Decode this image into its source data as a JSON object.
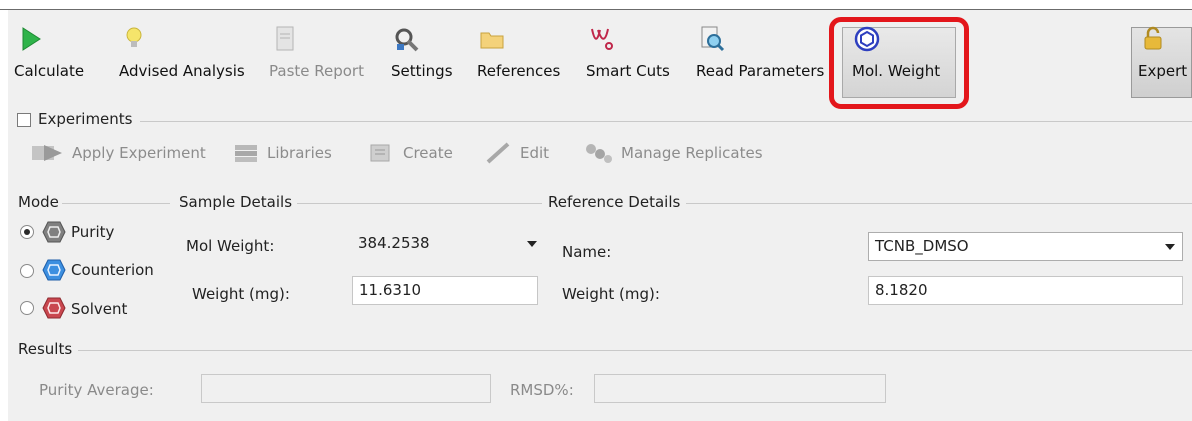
{
  "toolbar": {
    "calculate": "Calculate",
    "advised_analysis": "Advised Analysis",
    "paste_report": "Paste Report",
    "settings": "Settings",
    "references": "References",
    "smart_cuts": "Smart Cuts",
    "read_parameters": "Read Parameters",
    "mol_weight": "Mol. Weight",
    "expert": "Expert"
  },
  "experiments": {
    "title": "Experiments",
    "checked": false,
    "apply": "Apply Experiment",
    "libraries": "Libraries",
    "create": "Create",
    "edit": "Edit",
    "manage_replicates": "Manage Replicates"
  },
  "mode": {
    "title": "Mode",
    "options": [
      {
        "label": "Purity",
        "selected": true,
        "color": "#808080"
      },
      {
        "label": "Counterion",
        "selected": false,
        "color": "#3d8fe0"
      },
      {
        "label": "Solvent",
        "selected": false,
        "color": "#c9474f"
      }
    ]
  },
  "sample": {
    "title": "Sample Details",
    "mol_weight_label": "Mol Weight:",
    "mol_weight_value": "384.2538",
    "weight_label": "Weight (mg):",
    "weight_value": "11.6310"
  },
  "reference": {
    "title": "Reference Details",
    "name_label": "Name:",
    "name_value": "TCNB_DMSO",
    "weight_label": "Weight (mg):",
    "weight_value": "8.1820"
  },
  "results": {
    "title": "Results",
    "purity_avg_label": "Purity Average:",
    "purity_avg_value": "",
    "rmsd_label": "RMSD%:",
    "rmsd_value": ""
  },
  "colors": {
    "highlight": "#e3161b",
    "panel_bg": "#f0f0f0"
  }
}
